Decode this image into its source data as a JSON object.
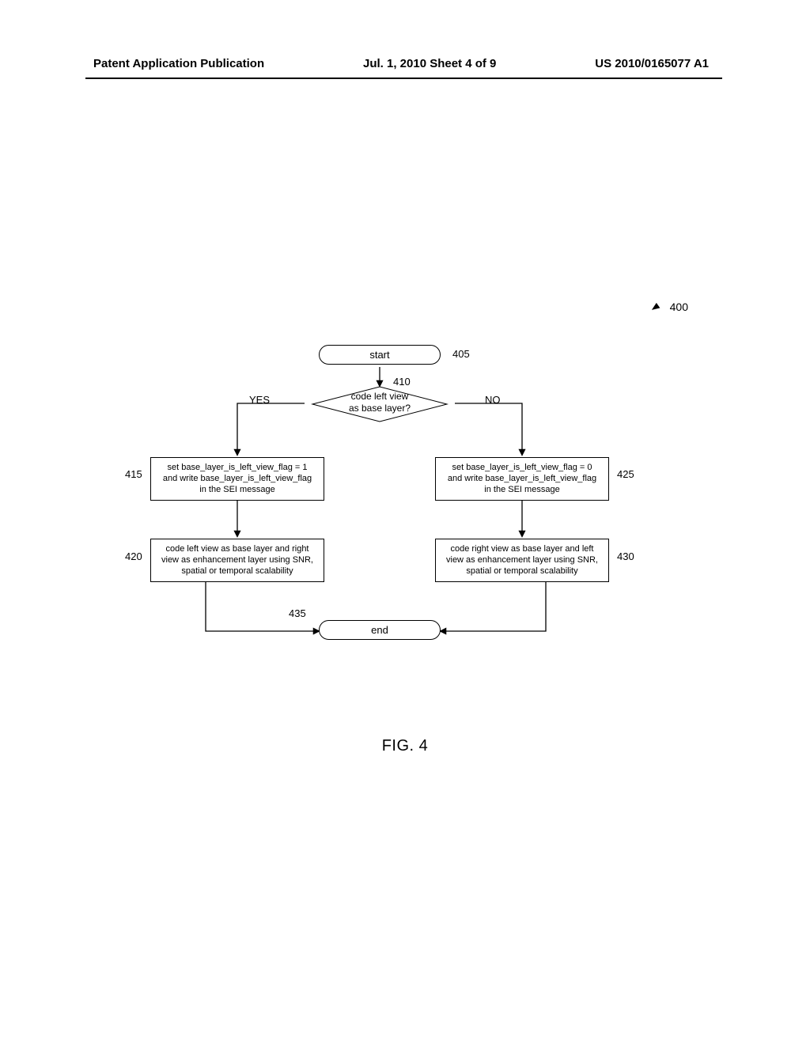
{
  "header": {
    "left": "Patent Application Publication",
    "center": "Jul. 1, 2010   Sheet 4 of 9",
    "right": "US 2010/0165077 A1"
  },
  "figure": {
    "ref": "400",
    "caption": "FIG. 4"
  },
  "flow": {
    "start": {
      "label": "start",
      "ref": "405"
    },
    "decision": {
      "label": "code left view\nas base layer?",
      "ref": "410",
      "yes": "YES",
      "no": "NO"
    },
    "left1": {
      "label": "set base_layer_is_left_view_flag = 1\nand write base_layer_is_left_view_flag\nin the SEI message",
      "ref": "415"
    },
    "left2": {
      "label": "code left view as base layer and right\nview as enhancement layer using SNR,\nspatial or temporal scalability",
      "ref": "420"
    },
    "right1": {
      "label": "set base_layer_is_left_view_flag = 0\nand write base_layer_is_left_view_flag\nin the SEI message",
      "ref": "425"
    },
    "right2": {
      "label": "code right view as base layer and left\nview as enhancement layer using SNR,\nspatial or temporal scalability",
      "ref": "430"
    },
    "end": {
      "label": "end",
      "ref": "435"
    }
  }
}
